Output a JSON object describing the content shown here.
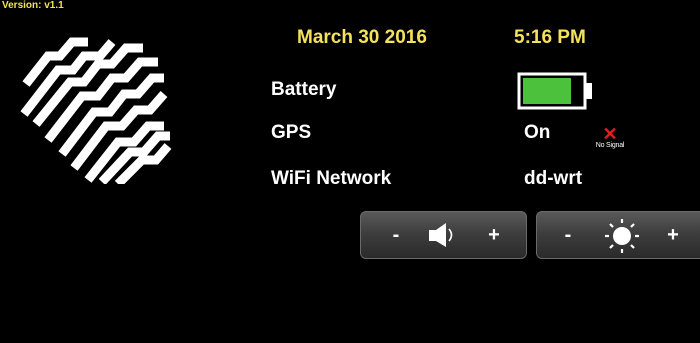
{
  "header": {
    "version": "Version: v1.1"
  },
  "datetime": {
    "date": "March 30 2016",
    "time": "5:16 PM"
  },
  "status": {
    "battery_label": "Battery",
    "battery_level": 0.8,
    "battery_color": "#4cc13b",
    "gps_label": "GPS",
    "gps_value": "On",
    "gps_signal_icon": "x-icon",
    "gps_signal_text": "No Signal",
    "gps_signal_color": "#e01f1f",
    "wifi_label": "WiFi Network",
    "wifi_value": "dd-wrt"
  },
  "controls": {
    "volume": {
      "minus": "-",
      "plus": "+",
      "icon": "speaker-icon"
    },
    "brightness": {
      "minus": "-",
      "plus": "+",
      "icon": "sun-icon"
    }
  },
  "colors": {
    "accent": "#f4e25a",
    "background": "#000000"
  }
}
